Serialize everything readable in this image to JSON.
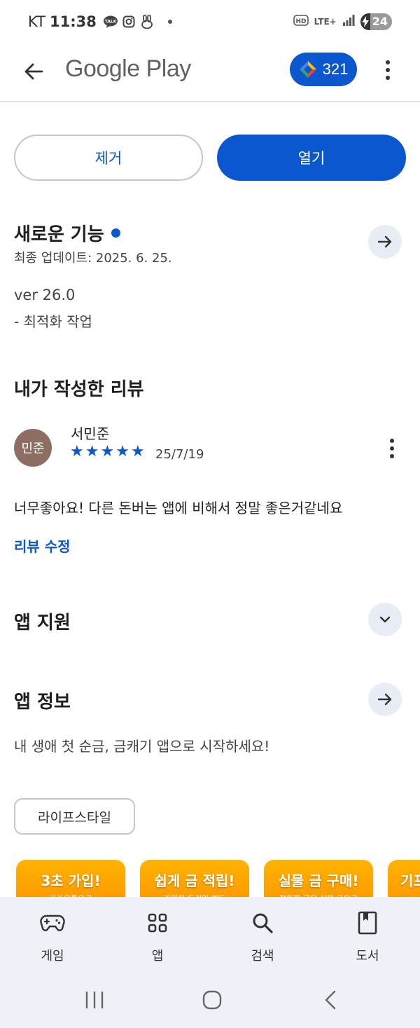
{
  "status_bar": {
    "carrier": "KT",
    "time": "11:38",
    "network": "LTE+",
    "battery": "24",
    "icons": [
      "talk-icon",
      "instagram-icon",
      "rabbit-icon",
      "dot-icon",
      "hd-icon",
      "lte-icon",
      "signal-icon",
      "battery-icon"
    ]
  },
  "header": {
    "brand": "Google Play",
    "points": "321",
    "icons": [
      "back-arrow-icon",
      "play-points-icon",
      "more-vert-icon"
    ]
  },
  "actions": {
    "uninstall_label": "제거",
    "open_label": "열기"
  },
  "whats_new": {
    "title": "새로운 기능",
    "updated": "최종 업데이트: 2025. 6. 25.",
    "version": "ver 26.0",
    "notes": "- 최적화 작업"
  },
  "my_review": {
    "title": "내가 작성한 리뷰",
    "avatar_text": "민준",
    "reviewer": "서민준",
    "rating": 5,
    "date": "25/7/19",
    "text": "너무좋아요! 다른 돈버는 앱에 비해서 정말 좋은거같네요",
    "edit_label": "리뷰 수정"
  },
  "app_support": {
    "title": "앱 지원"
  },
  "app_info": {
    "title": "앱 정보",
    "description": "내 생애 첫 순금, 금캐기 앱으로 시작하세요!",
    "category": "라이프스타일"
  },
  "screenshots": [
    {
      "title": "3초 가입!",
      "sub": "카카오톡으로"
    },
    {
      "title": "쉽게 금 적립!",
      "sub": "가만히 두기만 해도"
    },
    {
      "title": "실물 금 구매!",
      "sub": "적립한 금을 실물 금으로"
    },
    {
      "title": "기프",
      "sub": ""
    }
  ],
  "bottom_nav": {
    "items": [
      {
        "label": "게임"
      },
      {
        "label": "앱"
      },
      {
        "label": "검색"
      },
      {
        "label": "도서"
      }
    ]
  },
  "colors": {
    "accent": "#0b57d0",
    "chip_bg": "#e8edf5",
    "nav_bg": "#eef2f8"
  }
}
